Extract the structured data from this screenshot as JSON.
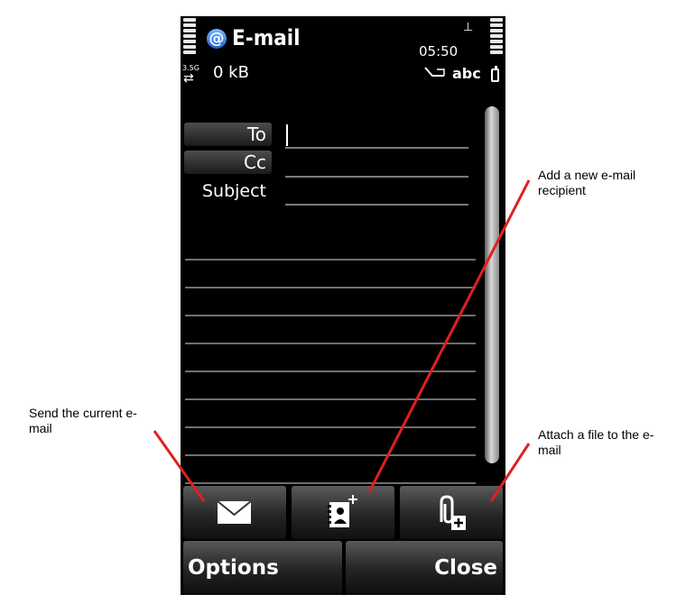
{
  "status": {
    "title": "E-mail",
    "title_icon": "@",
    "size": "0 kB",
    "time": "05:50",
    "network_badge": "3.5G",
    "input_mode": "abc"
  },
  "form": {
    "to_label": "To",
    "cc_label": "Cc",
    "subject_label": "Subject",
    "to_value": "",
    "cc_value": "",
    "subject_value": ""
  },
  "toolbar": {
    "send_icon": "envelope-icon",
    "add_recipient_icon": "add-contact-icon",
    "attach_icon": "attach-file-icon"
  },
  "softkeys": {
    "left": "Options",
    "right": "Close"
  },
  "annotations": {
    "add_recipient": "Add a new e-mail recipient",
    "send": "Send the current e-mail",
    "attach": "Attach a file to the e-mail"
  },
  "colors": {
    "annotation_arrow": "#e02020",
    "screen_bg": "#000000"
  }
}
